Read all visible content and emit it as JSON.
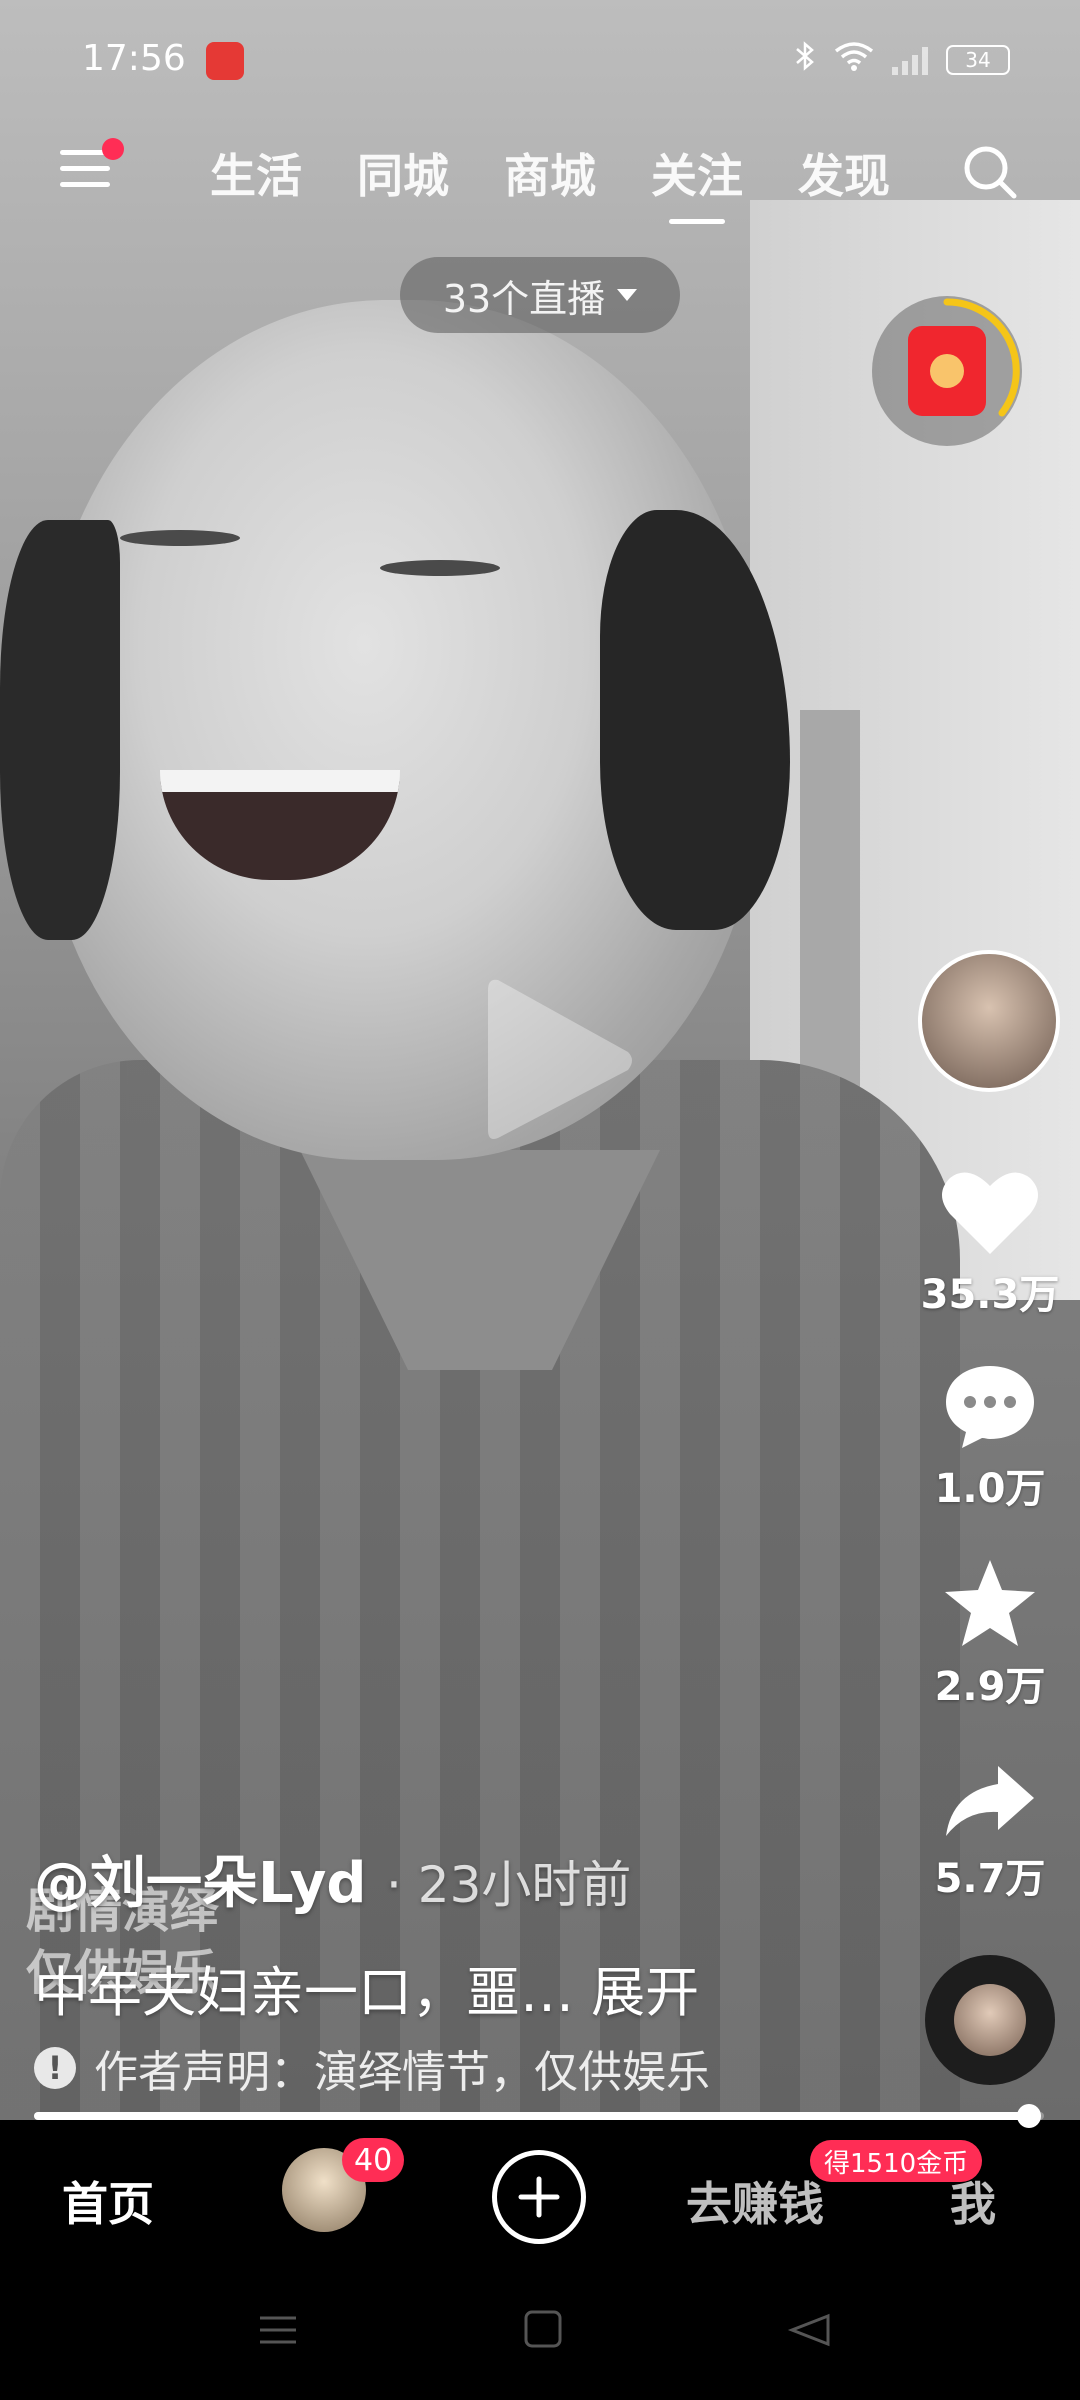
{
  "status_bar": {
    "time": "17:56",
    "battery": "34"
  },
  "top_nav": {
    "tabs": [
      {
        "label": "生活",
        "active": false
      },
      {
        "label": "同城",
        "active": false
      },
      {
        "label": "商城",
        "active": false
      },
      {
        "label": "关注",
        "active": true
      },
      {
        "label": "发现",
        "active": false
      }
    ]
  },
  "live_pill": {
    "label": "33个直播"
  },
  "actions": {
    "likes": "35.3万",
    "comments": "1.0万",
    "favorites": "2.9万",
    "shares": "5.7万"
  },
  "post": {
    "author": "@刘一朵Lyd",
    "time_ago": "· 23小时前",
    "caption": "中年夫妇亲一口，噩… 展开",
    "disclaimer": "作者声明：演绎情节，仅供娱乐",
    "watermark_line1": "剧情演绎",
    "watermark_line2": "仅供娱乐"
  },
  "playback": {
    "progress": 0.985
  },
  "bottom_nav": {
    "home": "首页",
    "friend_badge": "40",
    "earn": "去赚钱",
    "earn_badge": "得1510金币",
    "me": "我"
  },
  "colors": {
    "accent": "#ff2d55",
    "red_packet": "#f0262e",
    "ring": "#f5c518"
  }
}
